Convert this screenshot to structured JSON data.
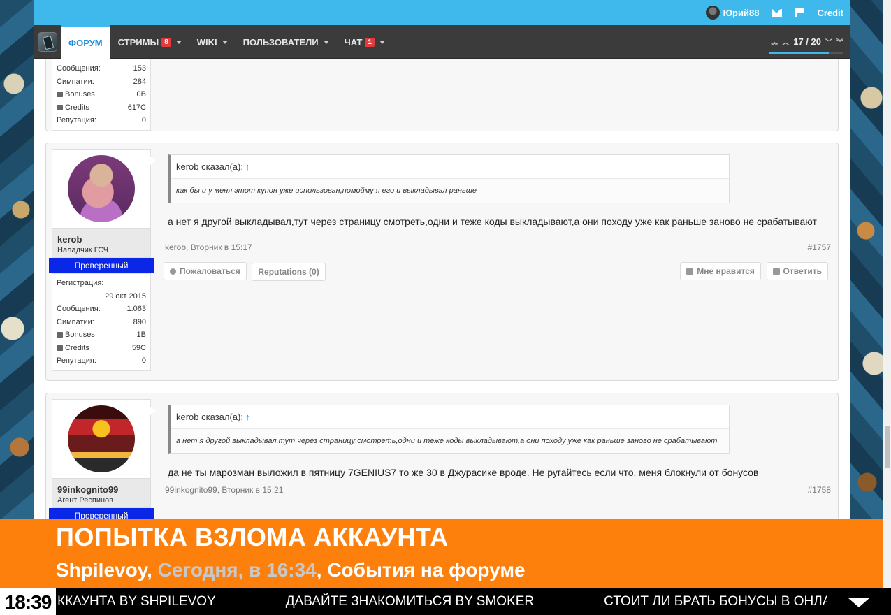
{
  "topbar": {
    "username": "Юрий88",
    "credit_label": "Credit"
  },
  "nav": {
    "items": [
      {
        "label": "ФОРУМ",
        "active": true
      },
      {
        "label": "СТРИМЫ",
        "badge": "8"
      },
      {
        "label": "WIKI"
      },
      {
        "label": "ПОЛЬЗОВАТЕЛИ"
      },
      {
        "label": "ЧАТ",
        "badge": "1"
      }
    ],
    "pager": "17 / 20"
  },
  "prev_post_stats": [
    {
      "label": "Сообщения:",
      "value": "153"
    },
    {
      "label": "Симпатии:",
      "value": "284"
    },
    {
      "label": "Bonuses",
      "value": "0B",
      "icon": "gift-icon"
    },
    {
      "label": "Credits",
      "value": "617C",
      "icon": "money-icon"
    },
    {
      "label": "Репутация:",
      "value": "0"
    }
  ],
  "posts": [
    {
      "username": "kerob",
      "user_title": "Наладчик ГСЧ",
      "verified": "Проверенный",
      "reg_label": "Регистрация:",
      "reg_date": "29 окт 2015",
      "stats": [
        {
          "label": "Сообщения:",
          "value": "1.063"
        },
        {
          "label": "Симпатии:",
          "value": "890"
        },
        {
          "label": "Bonuses",
          "value": "1B"
        },
        {
          "label": "Credits",
          "value": "59C"
        },
        {
          "label": "Репутация:",
          "value": "0"
        }
      ],
      "quote_author": "kerob сказал(а):",
      "quote_arrow": "↑",
      "quote_text": "как бы и у меня этот купон уже использован,помойму я его и выкладывал раньше",
      "text": "а нет я другой выкладывал,тут через страницу смотреть,одни и теже коды выкладывают,а они походу уже как раньше заново не срабатывают",
      "meta_author": "kerob",
      "meta_time": ", Вторник в 15:17",
      "post_number": "#1757",
      "actions": {
        "report": "Пожаловаться",
        "reputations": "Reputations (0)",
        "like": "Мне нравится",
        "reply": "Ответить"
      }
    },
    {
      "username": "99inkognito99",
      "user_title": "Агент Респинов",
      "verified": "Проверенный",
      "quote_author": "kerob сказал(а):",
      "quote_arrow": "↑",
      "quote_text": "а нет я другой выкладывал,тут через страницу смотреть,одни и теже коды выкладывают,а они походу уже как раньше заново не срабатывают",
      "text": "да не ты марозман выложил в пятницу 7GENIUS7 то же 30 в Джурасике вроде. Не ругайтесь если что, меня блокнули от бонусов",
      "meta_author": "99inkognito99",
      "meta_time": ", Вторник в 15:21",
      "post_number": "#1758"
    }
  ],
  "notification": {
    "title": "ПОПЫТКА ВЗЛОМА АККАУНТА",
    "author": "Shpilevoy,",
    "time": "Сегодня, в 16:34",
    "section": ", События на форуме"
  },
  "ticker": {
    "clock": "18:39",
    "items": [
      "ККАУНТА BY SHPILEVOY",
      "ДАВАЙТЕ ЗНАКОМИТЬСЯ BY SMOKER",
      "СТОИТ ЛИ БРАТЬ БОНУСЫ В ОНЛАЙН КАЗИ"
    ]
  }
}
